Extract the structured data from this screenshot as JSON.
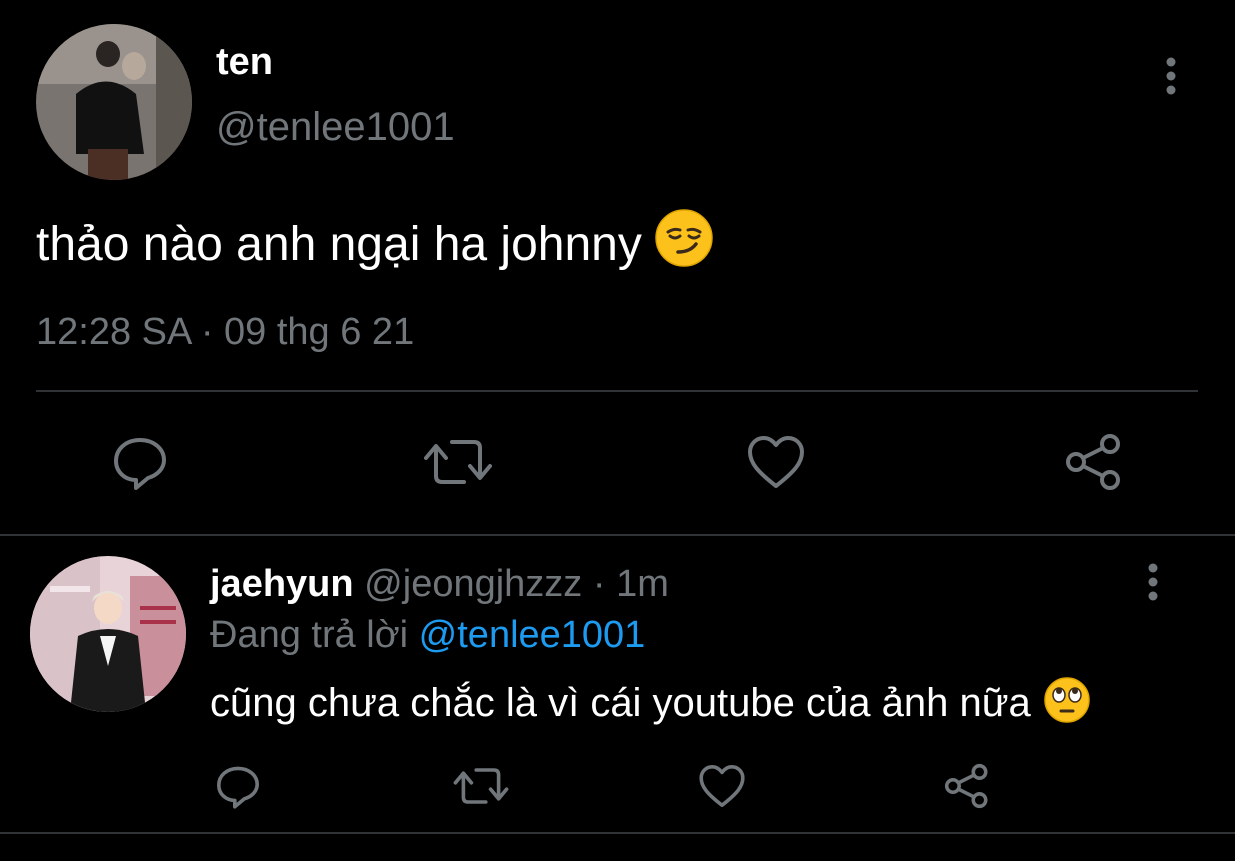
{
  "main_tweet": {
    "display_name": "ten",
    "handle": "@tenlee1001",
    "text": "thảo nào anh ngại ha johnny",
    "emoji": "smirking-face",
    "time": "12:28 SA",
    "separator": "·",
    "date": "09 thg 6 21",
    "actions": [
      "reply",
      "retweet",
      "like",
      "share"
    ]
  },
  "reply_tweet": {
    "display_name": "jaehyun",
    "handle": "@jeongjhzzz",
    "separator": "·",
    "time_ago": "1m",
    "replying_prefix": "Đang trả lời",
    "replying_to": "@tenlee1001",
    "text": "cũng chưa chắc là vì cái youtube của ảnh nữa",
    "emoji": "face-with-rolling-eyes",
    "actions": [
      "reply",
      "retweet",
      "like",
      "share"
    ]
  },
  "colors": {
    "background": "#000000",
    "primary_text": "#ffffff",
    "secondary_text": "#71767b",
    "mention": "#1d9bf0",
    "divider": "#2f3336",
    "emoji_yellow": "#fcc21b"
  }
}
